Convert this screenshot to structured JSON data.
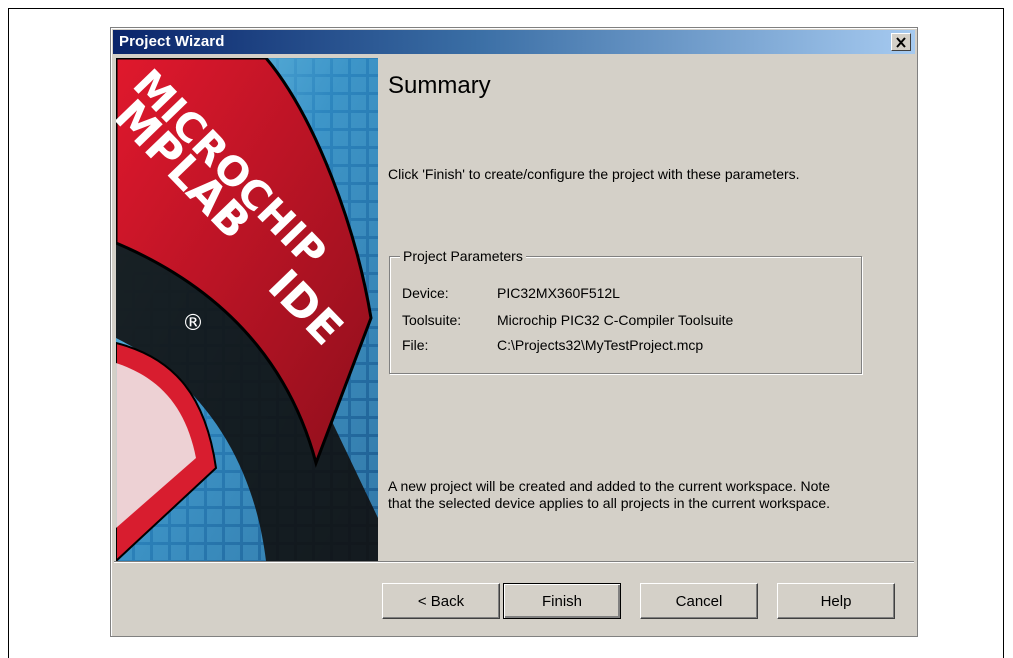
{
  "window": {
    "title": "Project Wizard"
  },
  "banner": {
    "brand_line1": "MICROCHIP",
    "brand_line2": "MPLAB",
    "brand_line3": "IDE",
    "registered_mark": "®"
  },
  "page": {
    "heading": "Summary",
    "instruction": "Click 'Finish' to create/configure the project with these parameters.",
    "note": "A new project will be created and added to the current workspace.  Note that the selected device applies to all projects in the current workspace."
  },
  "parameters": {
    "group_title": "Project Parameters",
    "rows": [
      {
        "label": "Device:",
        "value": "PIC32MX360F512L"
      },
      {
        "label": "Toolsuite:",
        "value": "Microchip PIC32 C-Compiler Toolsuite"
      },
      {
        "label": "File:",
        "value": "C:\\Projects32\\MyTestProject.mcp"
      }
    ]
  },
  "buttons": {
    "back": "< Back",
    "finish": "Finish",
    "cancel": "Cancel",
    "help": "Help"
  },
  "colors": {
    "dialog_bg": "#d4d0c8",
    "titlebar_start": "#0a246a",
    "titlebar_end": "#a6caf0",
    "banner_red": "#c8102e"
  }
}
